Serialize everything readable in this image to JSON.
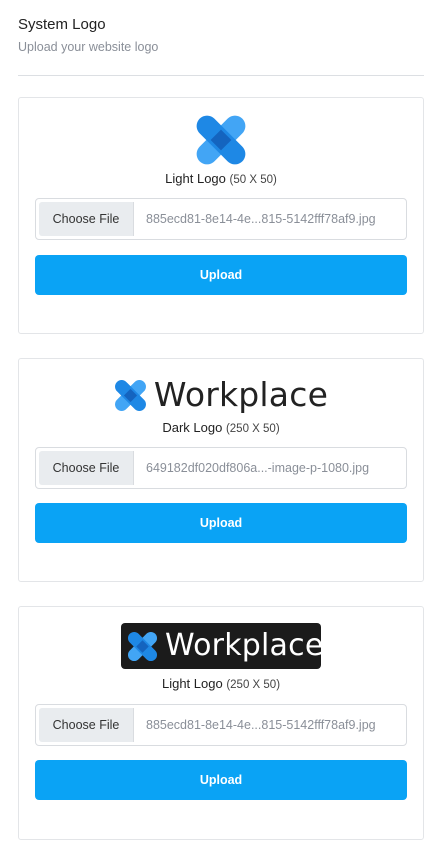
{
  "header": {
    "title": "System Logo",
    "subtitle": "Upload your website logo"
  },
  "cards": [
    {
      "logo_style": "icon-only",
      "label": "Light Logo",
      "dims": "(50 X 50)",
      "choose_label": "Choose File",
      "file_name": "885ecd81-8e14-4e...815-5142fff78af9.jpg",
      "upload_label": "Upload"
    },
    {
      "logo_style": "wordmark-dark-text",
      "logo_text": "Workplace",
      "label": "Dark Logo",
      "dims": "(250 X 50)",
      "choose_label": "Choose File",
      "file_name": "649182df020df806a...-image-p-1080.jpg",
      "upload_label": "Upload"
    },
    {
      "logo_style": "wordmark-on-black",
      "logo_text": "Workplace",
      "label": "Light Logo",
      "dims": "(250 X 50)",
      "choose_label": "Choose File",
      "file_name": "885ecd81-8e14-4e...815-5142fff78af9.jpg",
      "upload_label": "Upload"
    }
  ],
  "colors": {
    "accent": "#0aa3f5",
    "logo_blue_dark": "#1565c0",
    "logo_blue_light": "#42a5f5"
  }
}
